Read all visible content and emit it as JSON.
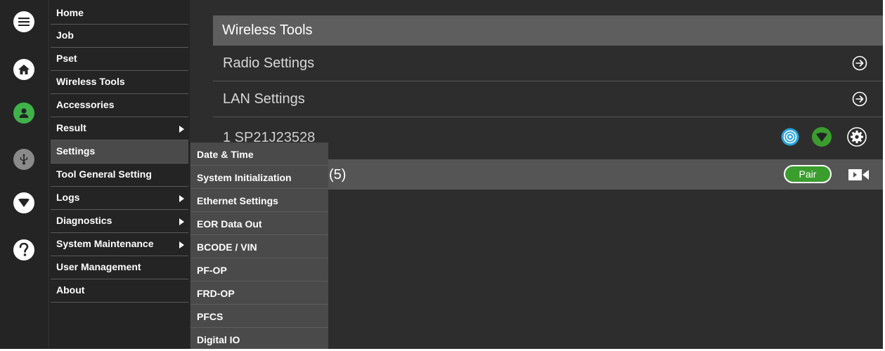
{
  "rail": {
    "icons": [
      "menu-icon",
      "home-icon",
      "user-icon",
      "usb-icon",
      "wifi-icon",
      "help-icon"
    ],
    "colors": {
      "white": "#ffffff",
      "green": "#3fb24a",
      "gray": "#8a8a8a"
    }
  },
  "menu": {
    "items": [
      {
        "label": "Home"
      },
      {
        "label": "Job"
      },
      {
        "label": "Pset"
      },
      {
        "label": "Wireless Tools"
      },
      {
        "label": "Accessories"
      },
      {
        "label": "Result"
      },
      {
        "label": "Settings"
      },
      {
        "label": "Tool General Setting"
      },
      {
        "label": "Logs"
      },
      {
        "label": "Diagnostics"
      },
      {
        "label": "System Maintenance"
      },
      {
        "label": "User Management"
      },
      {
        "label": "About"
      }
    ]
  },
  "submenu": {
    "items": [
      {
        "label": "Date & Time"
      },
      {
        "label": "System Initialization"
      },
      {
        "label": "Ethernet Settings"
      },
      {
        "label": "EOR Data Out"
      },
      {
        "label": "BCODE / VIN"
      },
      {
        "label": "PF-OP"
      },
      {
        "label": "FRD-OP"
      },
      {
        "label": "PFCS"
      },
      {
        "label": "Digital IO"
      }
    ]
  },
  "main": {
    "header": "Wireless Tools",
    "radio_settings": "Radio Settings",
    "lan_settings": "LAN Settings",
    "tool_label": "1 SP21J23528",
    "pair_row_label": "(5)",
    "pair_button": "Pair",
    "accent_blue": "#29a3d9",
    "accent_green": "#3a9d2e"
  }
}
